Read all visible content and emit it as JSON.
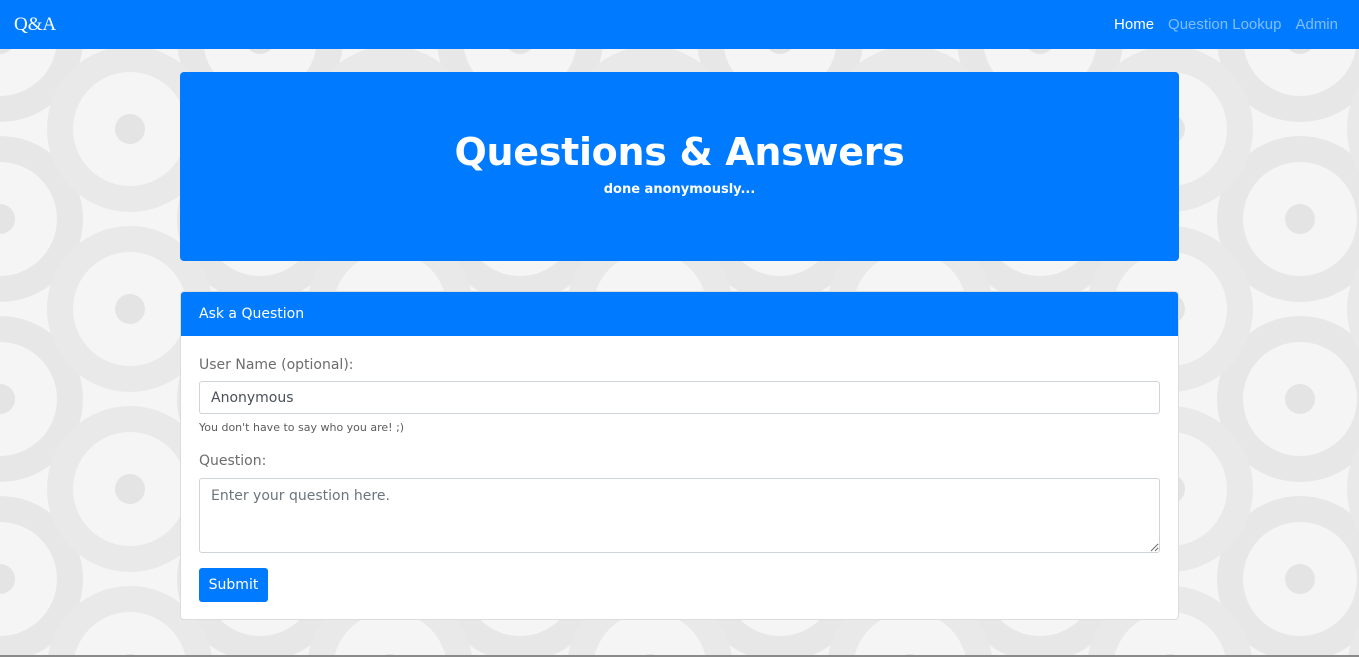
{
  "navbar": {
    "brand": "Q&A",
    "links": [
      {
        "label": "Home",
        "active": true
      },
      {
        "label": "Question Lookup",
        "active": false
      },
      {
        "label": "Admin",
        "active": false
      }
    ]
  },
  "jumbotron": {
    "title": "Questions & Answers",
    "subtitle": "done anonymously..."
  },
  "form": {
    "header": "Ask a Question",
    "username_label": "User Name (optional):",
    "username_value": "Anonymous",
    "username_help": "You don't have to say who you are! ;)",
    "question_label": "Question:",
    "question_placeholder": "Enter your question here.",
    "submit_label": "Submit"
  },
  "colors": {
    "primary": "#007bff",
    "background_pattern": "#e6e6e6"
  }
}
